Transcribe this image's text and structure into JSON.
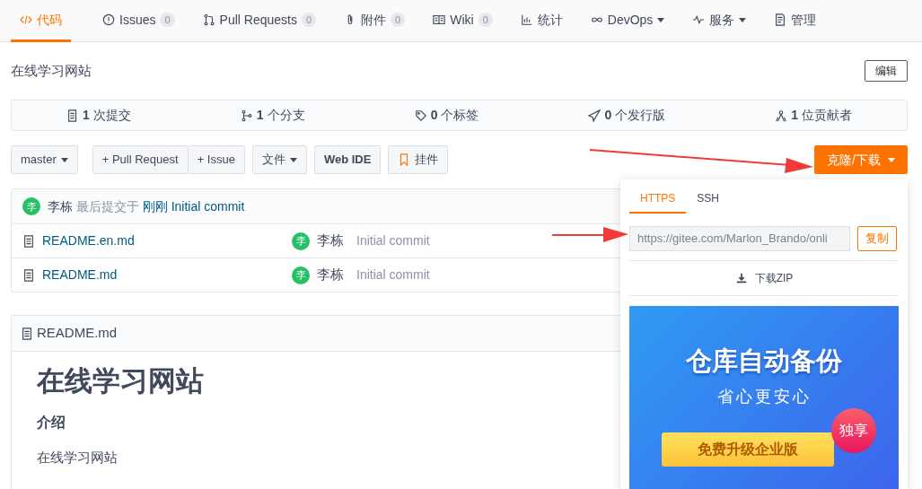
{
  "nav": {
    "tabs": [
      {
        "label": "代码",
        "selected": true
      },
      {
        "label": "Issues",
        "count": "0",
        "selected": false
      },
      {
        "label": "Pull Requests",
        "count": "0",
        "selected": false
      },
      {
        "label": "附件",
        "count": "0",
        "selected": false
      },
      {
        "label": "Wiki",
        "count": "0",
        "selected": false
      },
      {
        "label": "统计",
        "selected": false
      },
      {
        "label": "DevOps",
        "caret": true,
        "selected": false
      },
      {
        "label": "服务",
        "caret": true,
        "selected": false
      },
      {
        "label": "管理",
        "selected": false
      }
    ]
  },
  "repo": {
    "title": "在线学习网站",
    "edit_button": "编辑"
  },
  "stats": [
    {
      "count": "1",
      "label": "次提交"
    },
    {
      "count": "1",
      "label": "个分支"
    },
    {
      "count": "0",
      "label": "个标签"
    },
    {
      "count": "0",
      "label": "个发行版"
    },
    {
      "count": "1",
      "label": "位贡献者"
    }
  ],
  "toolbar": {
    "branch": "master",
    "buttons": [
      {
        "label": "+ Pull Request",
        "kind": "group"
      },
      {
        "label": "+ Issue",
        "kind": "group"
      },
      {
        "label": "文件",
        "kind": "menu"
      },
      {
        "label": "Web IDE",
        "kind": "bold"
      },
      {
        "label": "挂件",
        "kind": "widget"
      }
    ],
    "clone_button": "克隆/下载"
  },
  "last_commit": {
    "avatar": "李",
    "author": "李栋",
    "prefix": "最后提交于",
    "time": "刚刚",
    "message": "Initial commit"
  },
  "files": [
    {
      "name": "README.en.md",
      "avatar": "李",
      "author": "李栋",
      "message": "Initial commit"
    },
    {
      "name": "README.md",
      "avatar": "李",
      "author": "李栋",
      "message": "Initial commit"
    }
  ],
  "readme": {
    "file": "README.md",
    "heading": "在线学习网站",
    "subheading": "介绍",
    "text": "在线学习网站"
  },
  "clone_panel": {
    "tabs": [
      {
        "label": "HTTPS",
        "selected": true
      },
      {
        "label": "SSH",
        "selected": false
      }
    ],
    "url": "https://gitee.com/Marlon_Brando/onli",
    "copy_button": "复制",
    "download": "下载ZIP",
    "banner": {
      "title": "仓库自动备份",
      "subtitle": "省心更安心",
      "button": "免费升级企业版",
      "badge": "独享"
    }
  }
}
